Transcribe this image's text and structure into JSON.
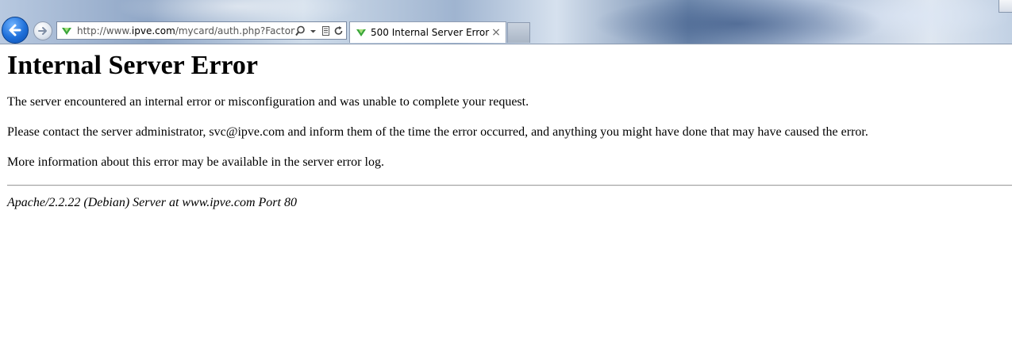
{
  "browser": {
    "address_url_prefix": "http://www.",
    "address_url_host": "ipve.com",
    "address_url_rest": "/mycard/auth.php?Factory",
    "tab_title": "500 Internal Server Error",
    "tab_close_glyph": "×",
    "icons": {
      "back": "back-arrow-icon",
      "forward": "forward-arrow-icon",
      "site": "site-favicon-icon",
      "search": "search-icon",
      "dropdown": "chevron-down-icon",
      "compat": "compatibility-view-icon",
      "refresh": "refresh-icon",
      "close": "close-icon"
    },
    "colors": {
      "back_button": "#1e6fd9",
      "favicon": "#3aa63a"
    }
  },
  "page": {
    "heading": "Internal Server Error",
    "paragraph_1": "The server encountered an internal error or misconfiguration and was unable to complete your request.",
    "paragraph_2": "Please contact the server administrator, svc@ipve.com and inform them of the time the error occurred, and anything you might have done that may have caused the error.",
    "paragraph_3": "More information about this error may be available in the server error log.",
    "server_signature": "Apache/2.2.22 (Debian) Server at www.ipve.com Port 80"
  }
}
